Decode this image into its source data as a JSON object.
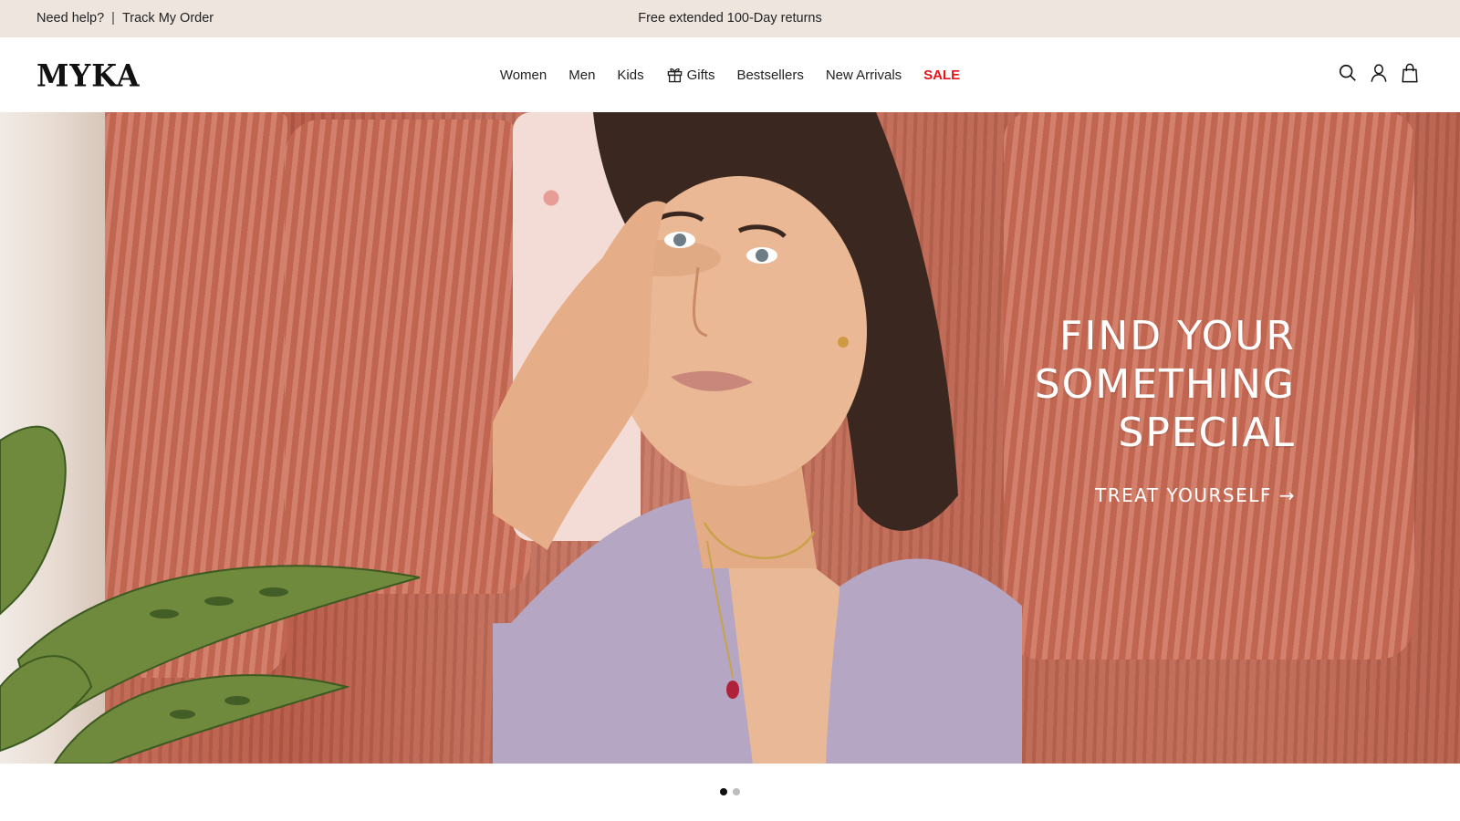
{
  "announcement": {
    "help_label": "Need help?",
    "separator": "|",
    "track_label": "Track My Order",
    "promo_text": "Free extended 100-Day returns"
  },
  "header": {
    "logo": "MYKA",
    "nav": [
      {
        "label": "Women"
      },
      {
        "label": "Men"
      },
      {
        "label": "Kids"
      },
      {
        "label": "Gifts",
        "icon": "gift-icon"
      },
      {
        "label": "Bestsellers"
      },
      {
        "label": "New Arrivals"
      },
      {
        "label": "SALE",
        "color": "#e3141c"
      }
    ],
    "icons": [
      "search-icon",
      "account-icon",
      "shopping-bag-icon"
    ]
  },
  "hero": {
    "headline": "FIND YOUR\nSOMETHING\nSPECIAL",
    "cta": "TREAT YOURSELF →"
  },
  "carousel": {
    "slide_count": 2,
    "active_index": 0
  },
  "colors": {
    "announcement_bg": "#efe5df",
    "sale": "#e3141c",
    "dot_active": "#111111",
    "dot_inactive": "#bdbdbd"
  }
}
